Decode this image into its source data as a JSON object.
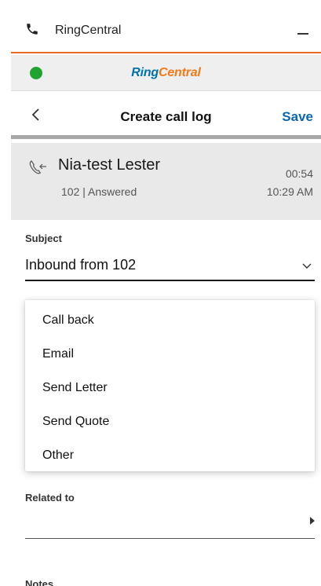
{
  "titlebar": {
    "title": "RingCentral"
  },
  "brand": {
    "ring": "Ring",
    "central": "Central"
  },
  "header": {
    "back_icon": "chevron-left-icon",
    "title": "Create call log",
    "save_label": "Save"
  },
  "call": {
    "name": "Nia-test Lester",
    "duration": "00:54",
    "meta": "102 | Answered",
    "time": "10:29 AM"
  },
  "subject": {
    "label": "Subject",
    "value": "Inbound from 102"
  },
  "dropdown": {
    "options": [
      "Call back",
      "Email",
      "Send Letter",
      "Send Quote",
      "Other"
    ]
  },
  "related": {
    "label": "Related to"
  },
  "notes": {
    "label": "Notes"
  },
  "colors": {
    "accent": "#e8672b",
    "link": "#0b67b2",
    "presence": "#21a332",
    "brand_blue": "#0073ae",
    "brand_orange": "#f07a1a"
  }
}
